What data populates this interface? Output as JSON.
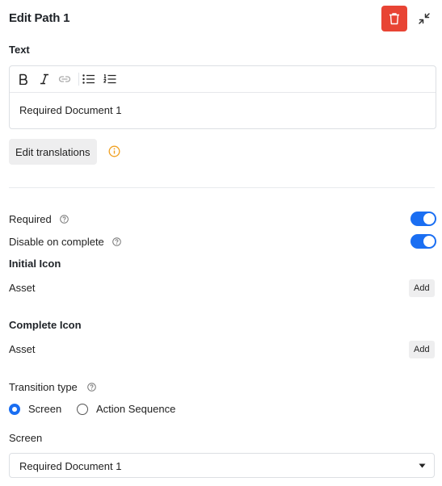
{
  "header": {
    "title": "Edit Path 1"
  },
  "text_section": {
    "label": "Text",
    "content": "Required Document 1",
    "toolbar": [
      "bold",
      "italic",
      "link",
      "bulleted-list",
      "numbered-list"
    ]
  },
  "edit_translations": {
    "label": "Edit translations"
  },
  "settings": {
    "required": {
      "label": "Required",
      "enabled": true
    },
    "disable_on_complete": {
      "label": "Disable on complete",
      "enabled": true
    }
  },
  "initial_icon": {
    "heading": "Initial Icon",
    "asset_label": "Asset",
    "add_label": "Add"
  },
  "complete_icon": {
    "heading": "Complete Icon",
    "asset_label": "Asset",
    "add_label": "Add"
  },
  "transition": {
    "label": "Transition type",
    "options": [
      "Screen",
      "Action Sequence"
    ],
    "selected": "Screen"
  },
  "screen": {
    "label": "Screen",
    "value": "Required Document 1"
  },
  "colors": {
    "accent": "#1a6ef2",
    "danger": "#e84434",
    "info": "#f0a020"
  }
}
